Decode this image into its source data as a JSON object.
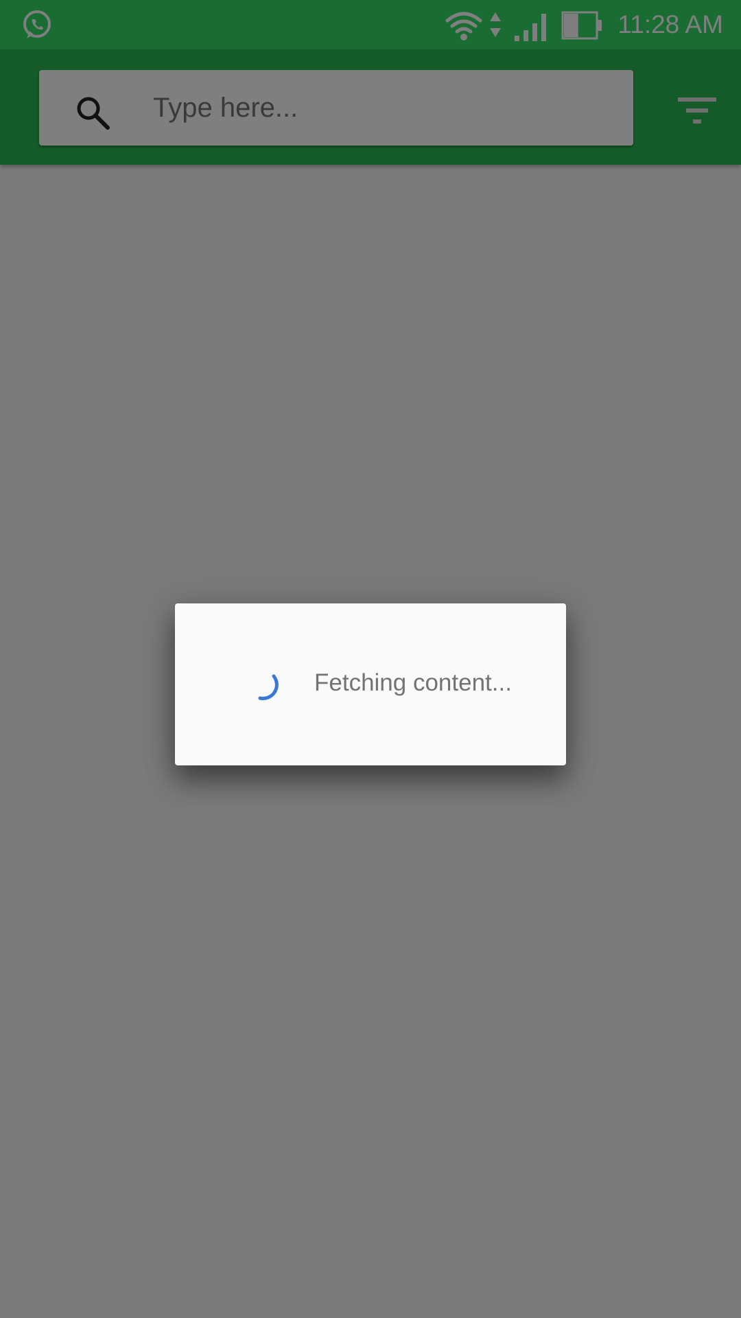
{
  "status_bar": {
    "notification_icon": "whatsapp-icon",
    "wifi_icon": "wifi-icon",
    "data_icon": "data-activity-icon",
    "signal_icon": "cell-signal-icon",
    "battery_icon": "battery-icon",
    "battery_level": 0.45,
    "time": "11:28 AM"
  },
  "toolbar": {
    "search_icon": "search-icon",
    "search_placeholder": "Type here...",
    "search_value": "",
    "filter_icon": "filter-icon"
  },
  "dialog": {
    "spinner_icon": "loading-spinner-icon",
    "message": "Fetching content..."
  },
  "colors": {
    "status_bar": "#34db64",
    "app_bar": "#2ab754",
    "spinner": "#3a78d6",
    "dialog_background": "#fafafa",
    "scrim": "rgba(0,0,0,0.5)"
  }
}
